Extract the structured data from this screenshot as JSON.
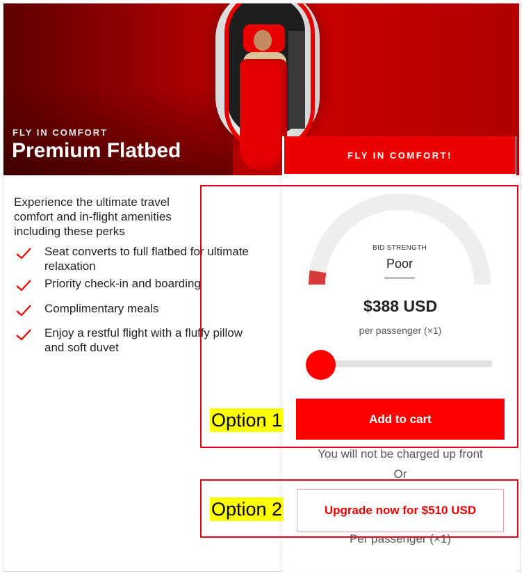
{
  "hero": {
    "kicker": "FLY IN COMFORT",
    "title": "Premium Flatbed"
  },
  "description": "Experience the ultimate travel comfort and in-flight amenities including these perks",
  "perks": [
    "Seat converts to full flatbed for ultimate relaxation",
    "Priority check-in and boarding",
    "Complimentary meals",
    "Enjoy a restful flight with a fluffy pillow and soft duvet"
  ],
  "card": {
    "cta_label": "FLY IN COMFORT!",
    "bid_strength_label": "BID STRENGTH",
    "bid_strength_value": "Poor",
    "gauge_level": 0.05,
    "price": "$388 USD",
    "per_passenger": "per passenger (×1)",
    "slider_level": 0.0,
    "add_to_cart_label": "Add to cart",
    "no_charge_note": "You will not be charged up front",
    "or_label": "Or",
    "upgrade_label": "Upgrade now for $510 USD",
    "per_passenger_2": "Per passenger (×1)"
  },
  "annotations": {
    "option1": "Option 1",
    "option2": "Option 2"
  },
  "colors": {
    "accent": "#ff0000",
    "annotation_box": "#e4001b",
    "annotation_highlight": "#ffff00"
  },
  "icons": {
    "perk_icon": "check-icon"
  }
}
